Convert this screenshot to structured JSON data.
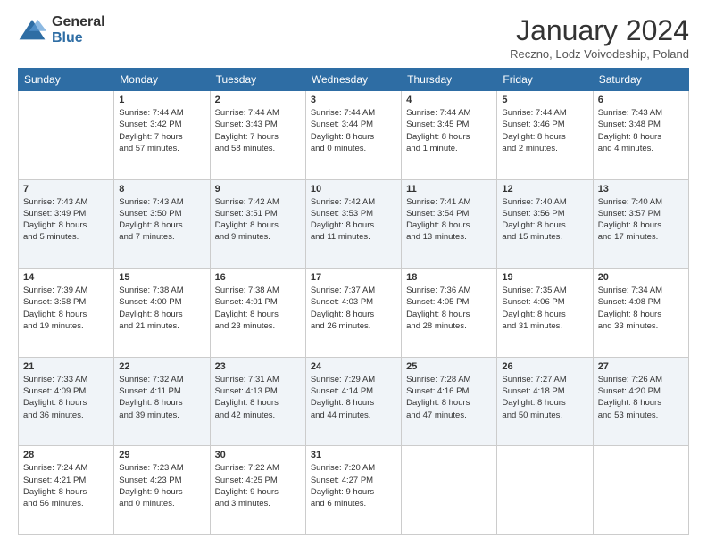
{
  "logo": {
    "general": "General",
    "blue": "Blue"
  },
  "header": {
    "month": "January 2024",
    "location": "Reczno, Lodz Voivodeship, Poland"
  },
  "weekdays": [
    "Sunday",
    "Monday",
    "Tuesday",
    "Wednesday",
    "Thursday",
    "Friday",
    "Saturday"
  ],
  "weeks": [
    [
      {
        "day": "",
        "info": ""
      },
      {
        "day": "1",
        "info": "Sunrise: 7:44 AM\nSunset: 3:42 PM\nDaylight: 7 hours\nand 57 minutes."
      },
      {
        "day": "2",
        "info": "Sunrise: 7:44 AM\nSunset: 3:43 PM\nDaylight: 7 hours\nand 58 minutes."
      },
      {
        "day": "3",
        "info": "Sunrise: 7:44 AM\nSunset: 3:44 PM\nDaylight: 8 hours\nand 0 minutes."
      },
      {
        "day": "4",
        "info": "Sunrise: 7:44 AM\nSunset: 3:45 PM\nDaylight: 8 hours\nand 1 minute."
      },
      {
        "day": "5",
        "info": "Sunrise: 7:44 AM\nSunset: 3:46 PM\nDaylight: 8 hours\nand 2 minutes."
      },
      {
        "day": "6",
        "info": "Sunrise: 7:43 AM\nSunset: 3:48 PM\nDaylight: 8 hours\nand 4 minutes."
      }
    ],
    [
      {
        "day": "7",
        "info": "Sunrise: 7:43 AM\nSunset: 3:49 PM\nDaylight: 8 hours\nand 5 minutes."
      },
      {
        "day": "8",
        "info": "Sunrise: 7:43 AM\nSunset: 3:50 PM\nDaylight: 8 hours\nand 7 minutes."
      },
      {
        "day": "9",
        "info": "Sunrise: 7:42 AM\nSunset: 3:51 PM\nDaylight: 8 hours\nand 9 minutes."
      },
      {
        "day": "10",
        "info": "Sunrise: 7:42 AM\nSunset: 3:53 PM\nDaylight: 8 hours\nand 11 minutes."
      },
      {
        "day": "11",
        "info": "Sunrise: 7:41 AM\nSunset: 3:54 PM\nDaylight: 8 hours\nand 13 minutes."
      },
      {
        "day": "12",
        "info": "Sunrise: 7:40 AM\nSunset: 3:56 PM\nDaylight: 8 hours\nand 15 minutes."
      },
      {
        "day": "13",
        "info": "Sunrise: 7:40 AM\nSunset: 3:57 PM\nDaylight: 8 hours\nand 17 minutes."
      }
    ],
    [
      {
        "day": "14",
        "info": "Sunrise: 7:39 AM\nSunset: 3:58 PM\nDaylight: 8 hours\nand 19 minutes."
      },
      {
        "day": "15",
        "info": "Sunrise: 7:38 AM\nSunset: 4:00 PM\nDaylight: 8 hours\nand 21 minutes."
      },
      {
        "day": "16",
        "info": "Sunrise: 7:38 AM\nSunset: 4:01 PM\nDaylight: 8 hours\nand 23 minutes."
      },
      {
        "day": "17",
        "info": "Sunrise: 7:37 AM\nSunset: 4:03 PM\nDaylight: 8 hours\nand 26 minutes."
      },
      {
        "day": "18",
        "info": "Sunrise: 7:36 AM\nSunset: 4:05 PM\nDaylight: 8 hours\nand 28 minutes."
      },
      {
        "day": "19",
        "info": "Sunrise: 7:35 AM\nSunset: 4:06 PM\nDaylight: 8 hours\nand 31 minutes."
      },
      {
        "day": "20",
        "info": "Sunrise: 7:34 AM\nSunset: 4:08 PM\nDaylight: 8 hours\nand 33 minutes."
      }
    ],
    [
      {
        "day": "21",
        "info": "Sunrise: 7:33 AM\nSunset: 4:09 PM\nDaylight: 8 hours\nand 36 minutes."
      },
      {
        "day": "22",
        "info": "Sunrise: 7:32 AM\nSunset: 4:11 PM\nDaylight: 8 hours\nand 39 minutes."
      },
      {
        "day": "23",
        "info": "Sunrise: 7:31 AM\nSunset: 4:13 PM\nDaylight: 8 hours\nand 42 minutes."
      },
      {
        "day": "24",
        "info": "Sunrise: 7:29 AM\nSunset: 4:14 PM\nDaylight: 8 hours\nand 44 minutes."
      },
      {
        "day": "25",
        "info": "Sunrise: 7:28 AM\nSunset: 4:16 PM\nDaylight: 8 hours\nand 47 minutes."
      },
      {
        "day": "26",
        "info": "Sunrise: 7:27 AM\nSunset: 4:18 PM\nDaylight: 8 hours\nand 50 minutes."
      },
      {
        "day": "27",
        "info": "Sunrise: 7:26 AM\nSunset: 4:20 PM\nDaylight: 8 hours\nand 53 minutes."
      }
    ],
    [
      {
        "day": "28",
        "info": "Sunrise: 7:24 AM\nSunset: 4:21 PM\nDaylight: 8 hours\nand 56 minutes."
      },
      {
        "day": "29",
        "info": "Sunrise: 7:23 AM\nSunset: 4:23 PM\nDaylight: 9 hours\nand 0 minutes."
      },
      {
        "day": "30",
        "info": "Sunrise: 7:22 AM\nSunset: 4:25 PM\nDaylight: 9 hours\nand 3 minutes."
      },
      {
        "day": "31",
        "info": "Sunrise: 7:20 AM\nSunset: 4:27 PM\nDaylight: 9 hours\nand 6 minutes."
      },
      {
        "day": "",
        "info": ""
      },
      {
        "day": "",
        "info": ""
      },
      {
        "day": "",
        "info": ""
      }
    ]
  ]
}
